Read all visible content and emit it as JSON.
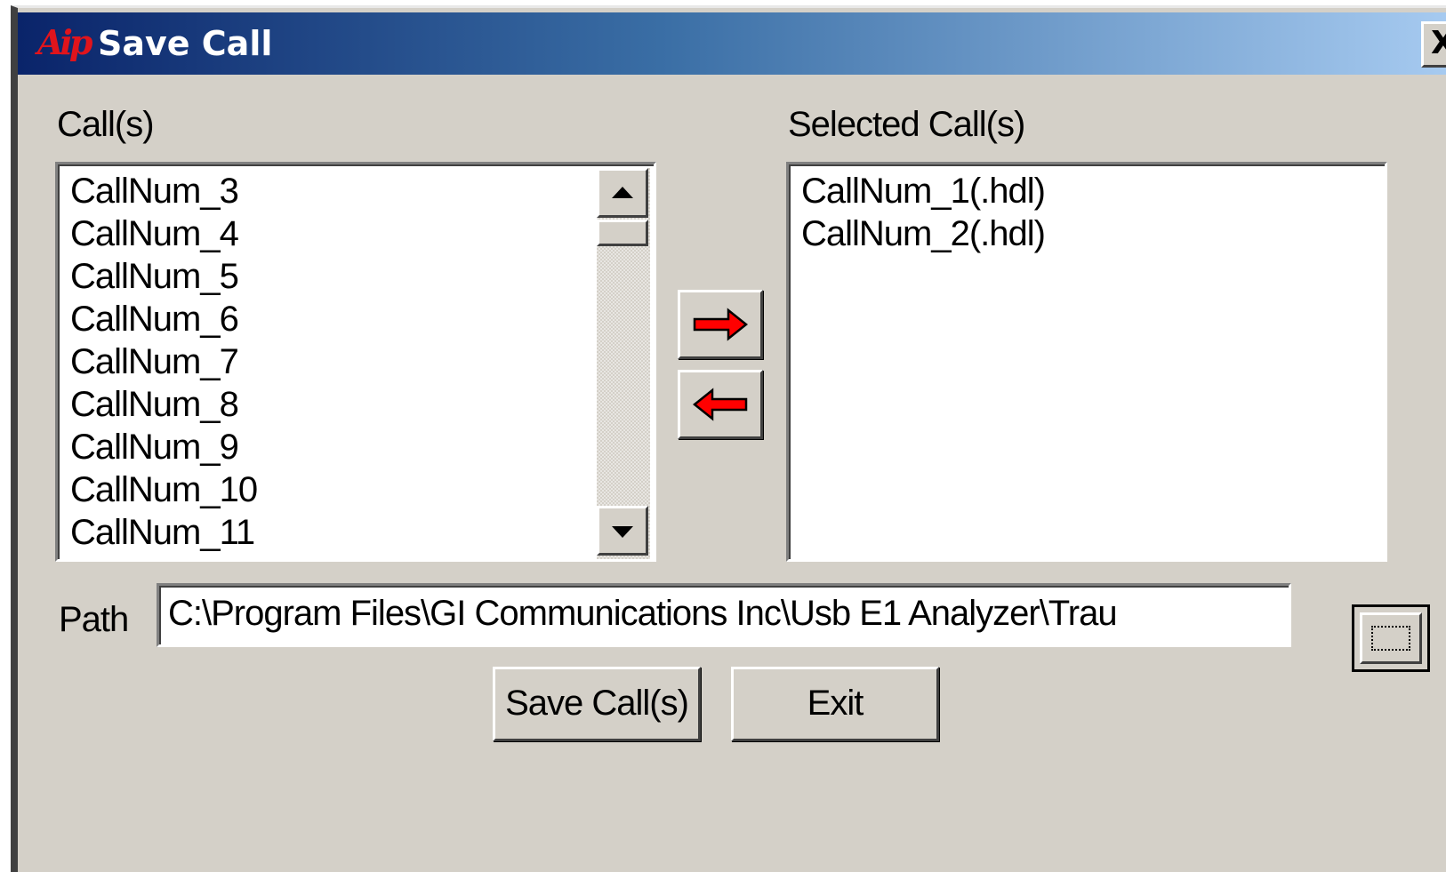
{
  "window": {
    "title": "Save Call",
    "app_icon_text": "Aip",
    "close_label": "X"
  },
  "calls": {
    "label": "Call(s)",
    "items": [
      "CallNum_3",
      "CallNum_4",
      "CallNum_5",
      "CallNum_6",
      "CallNum_7",
      "CallNum_8",
      "CallNum_9",
      "CallNum_10",
      "CallNum_11"
    ]
  },
  "selected": {
    "label": "Selected Call(s)",
    "items": [
      "CallNum_1(.hdl)",
      "CallNum_2(.hdl)"
    ]
  },
  "path": {
    "label": "Path",
    "value": "C:\\Program Files\\GI Communications Inc\\Usb E1 Analyzer\\Trau"
  },
  "buttons": {
    "save": "Save Call(s)",
    "exit": "Exit"
  },
  "colors": {
    "arrow": "#ff0000",
    "title_start": "#0a246a",
    "title_end": "#a6caf0",
    "dialog_bg": "#d4d0c8"
  }
}
